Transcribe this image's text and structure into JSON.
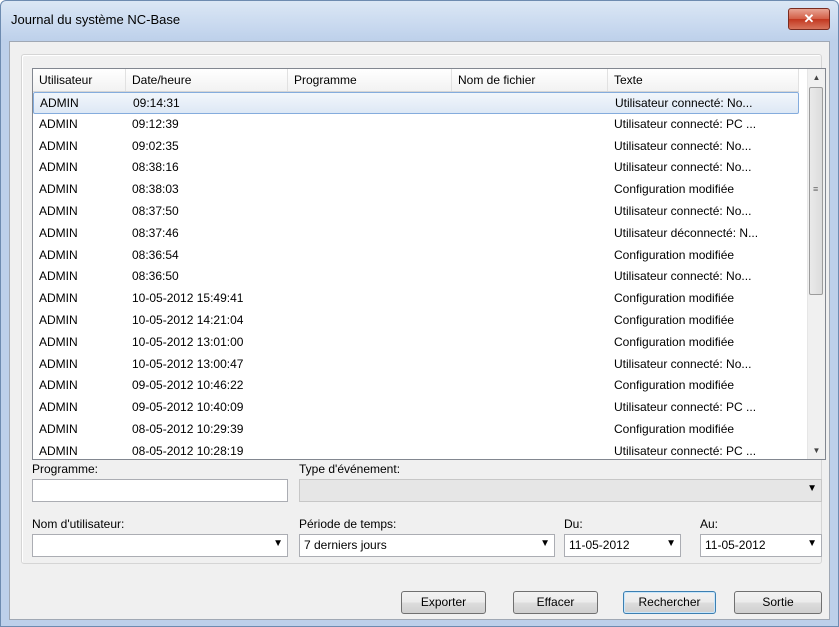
{
  "window": {
    "title": "Journal du système NC-Base",
    "close_label": "✕"
  },
  "list": {
    "columns": [
      "Utilisateur",
      "Date/heure",
      "Programme",
      "Nom de fichier",
      "Texte"
    ],
    "rows": [
      [
        "ADMIN",
        "09:14:31",
        "",
        "",
        "Utilisateur connecté: No..."
      ],
      [
        "ADMIN",
        "09:12:39",
        "",
        "",
        "Utilisateur connecté: PC ..."
      ],
      [
        "ADMIN",
        "09:02:35",
        "",
        "",
        "Utilisateur connecté: No..."
      ],
      [
        "ADMIN",
        "08:38:16",
        "",
        "",
        "Utilisateur connecté: No..."
      ],
      [
        "ADMIN",
        "08:38:03",
        "",
        "",
        "Configuration modifiée"
      ],
      [
        "ADMIN",
        "08:37:50",
        "",
        "",
        "Utilisateur connecté: No..."
      ],
      [
        "ADMIN",
        "08:37:46",
        "",
        "",
        "Utilisateur déconnecté: N..."
      ],
      [
        "ADMIN",
        "08:36:54",
        "",
        "",
        "Configuration modifiée"
      ],
      [
        "ADMIN",
        "08:36:50",
        "",
        "",
        "Utilisateur connecté: No..."
      ],
      [
        "ADMIN",
        "10-05-2012 15:49:41",
        "",
        "",
        "Configuration modifiée"
      ],
      [
        "ADMIN",
        "10-05-2012 14:21:04",
        "",
        "",
        "Configuration modifiée"
      ],
      [
        "ADMIN",
        "10-05-2012 13:01:00",
        "",
        "",
        "Configuration modifiée"
      ],
      [
        "ADMIN",
        "10-05-2012 13:00:47",
        "",
        "",
        "Utilisateur connecté: No..."
      ],
      [
        "ADMIN",
        "09-05-2012 10:46:22",
        "",
        "",
        "Configuration modifiée"
      ],
      [
        "ADMIN",
        "09-05-2012 10:40:09",
        "",
        "",
        "Utilisateur connecté: PC ..."
      ],
      [
        "ADMIN",
        "08-05-2012 10:29:39",
        "",
        "",
        "Configuration modifiée"
      ],
      [
        "ADMIN",
        "08-05-2012 10:28:19",
        "",
        "",
        "Utilisateur connecté: PC ..."
      ]
    ],
    "selected_row": 0
  },
  "filters": {
    "programme_label": "Programme:",
    "programme_value": "",
    "event_type_label": "Type d'événement:",
    "event_type_value": "",
    "username_label": "Nom d'utilisateur:",
    "username_value": "",
    "period_label": "Période de temps:",
    "period_value": "7 derniers jours",
    "from_label": "Du:",
    "from_value": "11-05-2012",
    "to_label": "Au:",
    "to_value": "11-05-2012"
  },
  "buttons": {
    "export": "Exporter",
    "clear": "Effacer",
    "search": "Rechercher",
    "exit": "Sortie"
  },
  "icons": {
    "dropdown": "▼",
    "scroll_up": "▲",
    "scroll_down": "▼",
    "grip": "≡"
  }
}
